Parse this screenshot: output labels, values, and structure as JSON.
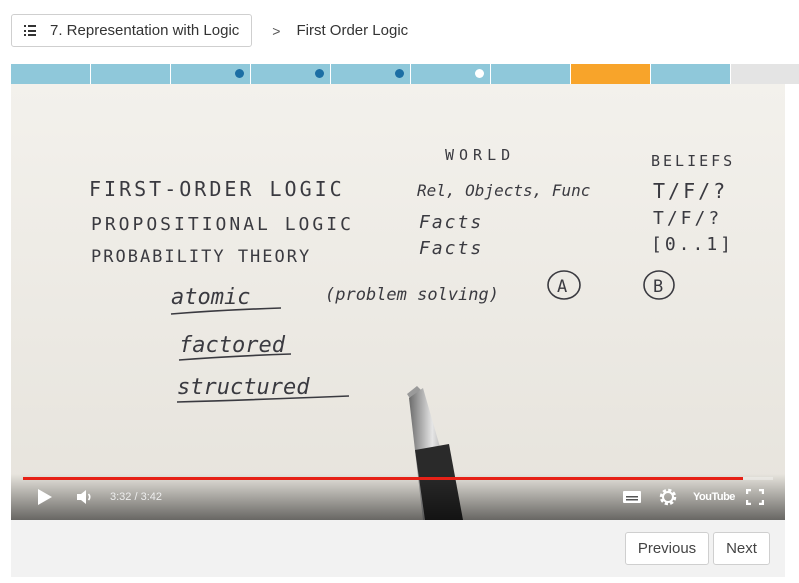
{
  "header": {
    "lesson_button_label": "7. Representation with Logic",
    "separator": ">",
    "current_page": "First Order Logic"
  },
  "progress": {
    "segments": [
      {
        "state": "done",
        "dot": false
      },
      {
        "state": "done",
        "dot": false
      },
      {
        "state": "done",
        "dot": true,
        "dot_color": "blue"
      },
      {
        "state": "done",
        "dot": true,
        "dot_color": "blue"
      },
      {
        "state": "done",
        "dot": true,
        "dot_color": "blue"
      },
      {
        "state": "done",
        "dot": true,
        "dot_color": "white"
      },
      {
        "state": "done",
        "dot": false
      },
      {
        "state": "current",
        "dot": false
      },
      {
        "state": "done",
        "dot": false
      },
      {
        "state": "upcoming",
        "dot": false
      }
    ],
    "colors": {
      "done": "#8fc8da",
      "current": "#f8a42a",
      "upcoming": "#e4e4e4",
      "dot": "#1c6ea4"
    }
  },
  "video": {
    "time_display": "3:32 / 3:42",
    "played_fraction": 0.96,
    "scrub_color": "#e62117",
    "youtube_logo_text": "YouTube",
    "whiteboard": {
      "world_heading": "WORLD",
      "beliefs_heading": "BELIEFS",
      "rows": [
        {
          "name": "FIRST-ORDER LOGIC",
          "world": "Rel, Objects, Func",
          "beliefs": "T/F/?"
        },
        {
          "name": "PROPOSITIONAL LOGIC",
          "world": "Facts",
          "beliefs": "T/F/?"
        },
        {
          "name": "PROBABILITY THEORY",
          "world": "Facts",
          "beliefs": "[0..1]"
        }
      ],
      "representations": [
        "atomic",
        "factored",
        "structured"
      ],
      "problem_solving_note": "(problem solving)",
      "circle_a": "A",
      "circle_b": "B"
    }
  },
  "nav": {
    "previous_label": "Previous",
    "next_label": "Next"
  }
}
